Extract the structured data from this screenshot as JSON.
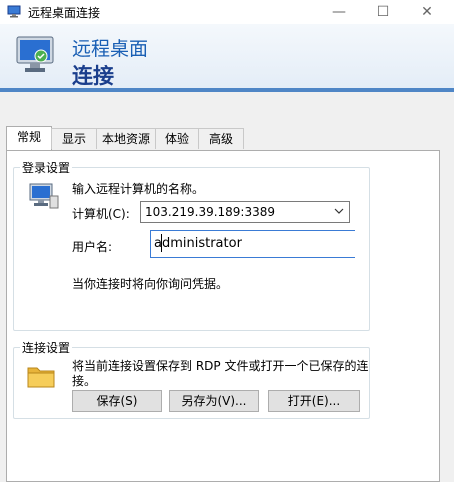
{
  "window": {
    "title": "远程桌面连接",
    "minimize": "—",
    "maximize": "☐",
    "close": "✕"
  },
  "header": {
    "line1": "远程桌面",
    "line2": "连接"
  },
  "tabs": [
    {
      "label": "常规",
      "active": true
    },
    {
      "label": "显示"
    },
    {
      "label": "本地资源"
    },
    {
      "label": "体验"
    },
    {
      "label": "高级"
    }
  ],
  "login_settings": {
    "title": "登录设置",
    "prompt": "输入远程计算机的名称。",
    "computer_label": "计算机(C):",
    "computer_value": "103.219.39.189:3389",
    "user_label": "用户名:",
    "user_value": "administrator",
    "note": "当你连接时将向你询问凭据。"
  },
  "connection_settings": {
    "title": "连接设置",
    "text_line1": "将当前连接设置保存到 RDP 文件或打开一个已保存的连",
    "text_line2": "接。",
    "save": "保存(S)",
    "save_as": "另存为(V)...",
    "open": "打开(E)..."
  },
  "colors": {
    "accent_blue": "#1a5fb4",
    "header_band": "#4f86c6"
  }
}
